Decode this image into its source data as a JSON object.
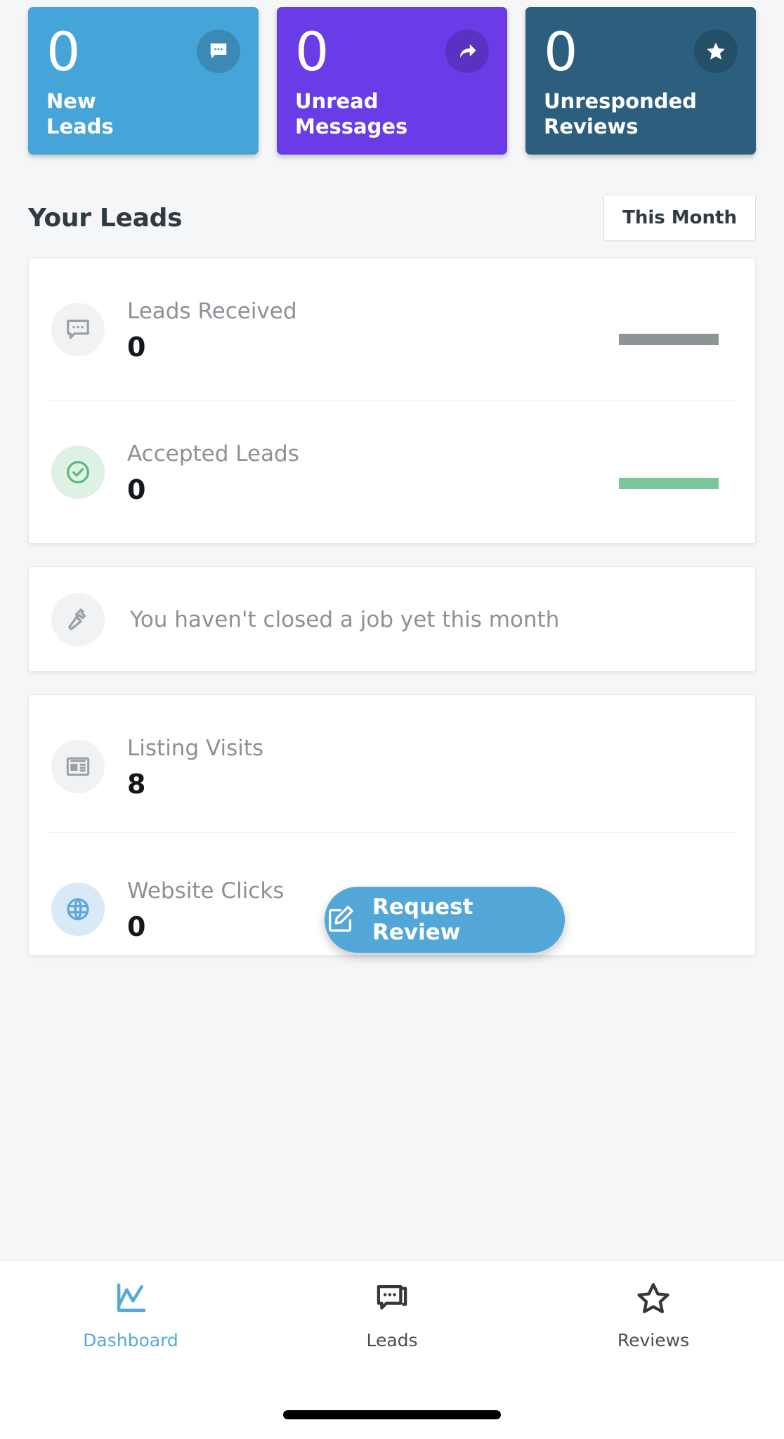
{
  "stats": {
    "cards": [
      {
        "value": "0",
        "label": "New\nLeads",
        "label_l1": "New",
        "label_l2": "Leads",
        "icon": "chat-bubble-icon",
        "color": "#46a5d8"
      },
      {
        "value": "0",
        "label": "Unread\nMessages",
        "label_l1": "Unread",
        "label_l2": "Messages",
        "icon": "share-arrow-icon",
        "color": "#6a3ce8"
      },
      {
        "value": "0",
        "label": "Unresponded\nReviews",
        "label_l1": "Unresponded",
        "label_l2": "Reviews",
        "icon": "star-icon",
        "color": "#2c5f7e"
      }
    ]
  },
  "section": {
    "title": "Your Leads",
    "period_label": "This Month"
  },
  "leads_panel": {
    "rows": [
      {
        "label": "Leads Received",
        "value": "0",
        "icon": "chat-bubble-icon",
        "spark_color": "#8e9396"
      },
      {
        "label": "Accepted Leads",
        "value": "0",
        "icon": "check-circle-icon",
        "spark_color": "#79c79a"
      }
    ]
  },
  "job_panel": {
    "message": "You haven't closed a job yet this month",
    "icon": "hammer-icon"
  },
  "traffic_panel": {
    "rows": [
      {
        "label": "Listing Visits",
        "value": "8",
        "icon": "newspaper-icon"
      },
      {
        "label": "Website Clicks",
        "value": "0",
        "icon": "globe-icon"
      }
    ]
  },
  "fab": {
    "label": "Request Review",
    "icon": "edit-pencil-icon",
    "color": "#53a7d8"
  },
  "bottom_nav": {
    "items": [
      {
        "label": "Dashboard",
        "icon": "line-chart-icon",
        "active": true
      },
      {
        "label": "Leads",
        "icon": "chat-bubble-icon",
        "active": false
      },
      {
        "label": "Reviews",
        "icon": "star-outline-icon",
        "active": false
      }
    ]
  }
}
